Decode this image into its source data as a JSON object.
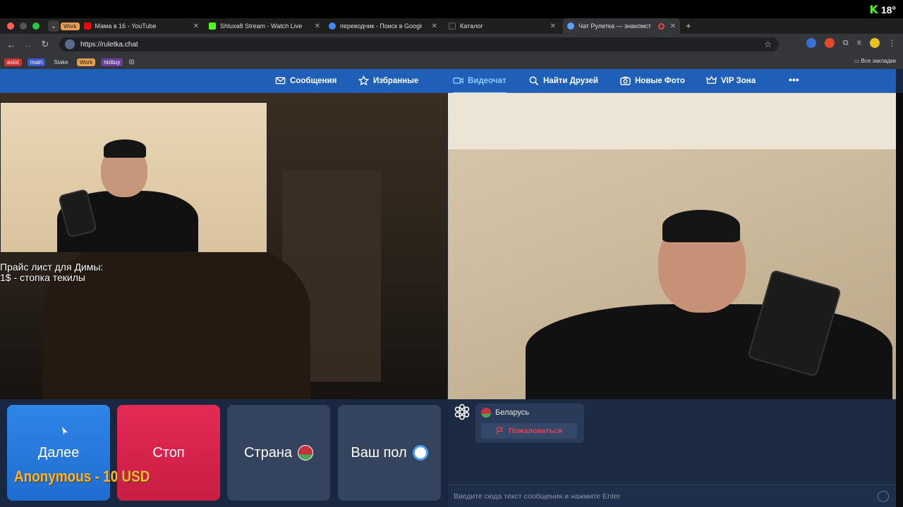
{
  "overlay": {
    "kick_temp": "18°"
  },
  "tabs": [
    {
      "badge": "Work",
      "label": "Мама в 16 - YouTube",
      "fav_color": "#ff0000"
    },
    {
      "label": "Shluxa8 Stream - Watch Live",
      "fav_color": "#53fc18"
    },
    {
      "label": "переводчик - Поиск в Google",
      "fav_color": "#4285f4"
    },
    {
      "label": "Каталог",
      "fav_color": "#999999"
    },
    {
      "label": "Чат Рулетка — знакомст",
      "fav_color": "#5aa0ff",
      "active": true
    }
  ],
  "address": {
    "url": "https://ruletka.chat"
  },
  "bookmarks": [
    {
      "label": "aslot",
      "color": "#c33"
    },
    {
      "label": "main",
      "color": "#3a5bd0"
    },
    {
      "label": "Stake",
      "color": "transparent"
    },
    {
      "label": "Work",
      "color": "#e8a050"
    },
    {
      "label": "nixbuy",
      "color": "#6b3fa0"
    }
  ],
  "all_bookmarks": "Все закладки",
  "site_nav": {
    "items": [
      {
        "label": "Сообщения",
        "icon": "envelope-icon"
      },
      {
        "label": "Избранные",
        "icon": "star-icon"
      },
      {
        "label": "Видеочат",
        "icon": "camera-icon",
        "active": true
      },
      {
        "label": "Найти Друзей",
        "icon": "search-icon"
      },
      {
        "label": "Новые Фото",
        "icon": "photo-icon"
      },
      {
        "label": "VIP Зона",
        "icon": "crown-icon"
      }
    ],
    "more": "•••"
  },
  "overlay_text": {
    "line1": "Прайс лист для Димы:",
    "line2": "1$ - стопка текилы"
  },
  "controls": {
    "next": "Далее",
    "stop": "Стоп",
    "country": "Страна",
    "gender": "Ваш пол"
  },
  "donation": "Anonymous - 10 USD",
  "chat": {
    "country": "Беларусь",
    "report": "Пожаловаться",
    "input_placeholder": "Введите сюда текст сообщения и нажмите Enter"
  },
  "colors": {
    "nav_bg": "#1f5fb8",
    "next_btn": "#2f86e6",
    "stop_btn": "#e42a55",
    "donation": "#f3b63a"
  }
}
